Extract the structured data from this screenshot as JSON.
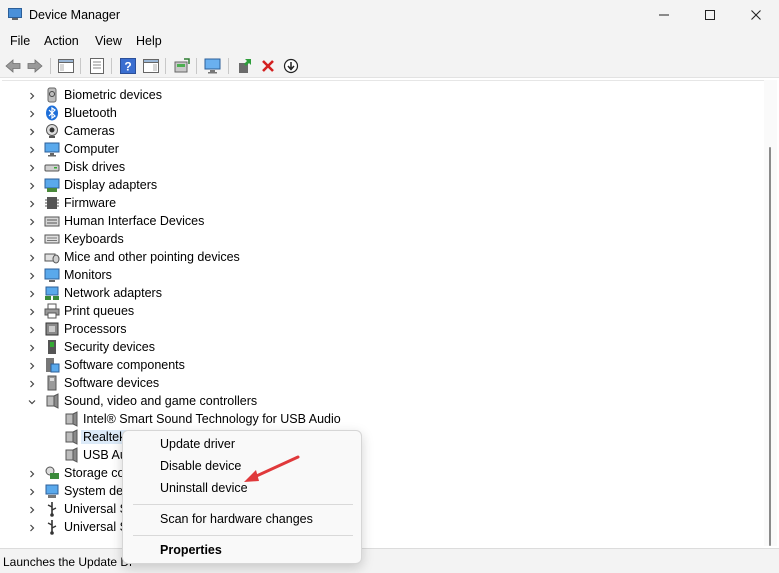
{
  "window": {
    "title": "Device Manager",
    "minimize_glyph": "—",
    "maximize_glyph": "☐",
    "close_glyph": "✕"
  },
  "menubar": {
    "items": [
      "File",
      "Action",
      "View",
      "Help"
    ]
  },
  "toolbar": {
    "icons": [
      "back-icon",
      "forward-icon",
      "show-hide-console-tree-icon",
      "properties-icon",
      "help-icon",
      "show-action-pane-icon",
      "update-driver-icon",
      "scan-hardware-icon",
      "enable-device-icon",
      "uninstall-device-icon",
      "disable-device-icon"
    ]
  },
  "tree": {
    "categories": [
      {
        "label": "Biometric devices",
        "icon": "biometric-icon",
        "expanded": false
      },
      {
        "label": "Bluetooth",
        "icon": "bluetooth-icon",
        "expanded": false
      },
      {
        "label": "Cameras",
        "icon": "camera-icon",
        "expanded": false
      },
      {
        "label": "Computer",
        "icon": "computer-icon",
        "expanded": false
      },
      {
        "label": "Disk drives",
        "icon": "disk-drive-icon",
        "expanded": false
      },
      {
        "label": "Display adapters",
        "icon": "display-adapter-icon",
        "expanded": false
      },
      {
        "label": "Firmware",
        "icon": "firmware-icon",
        "expanded": false
      },
      {
        "label": "Human Interface Devices",
        "icon": "hid-icon",
        "expanded": false
      },
      {
        "label": "Keyboards",
        "icon": "keyboard-icon",
        "expanded": false
      },
      {
        "label": "Mice and other pointing devices",
        "icon": "mouse-icon",
        "expanded": false
      },
      {
        "label": "Monitors",
        "icon": "monitor-icon",
        "expanded": false
      },
      {
        "label": "Network adapters",
        "icon": "network-adapter-icon",
        "expanded": false
      },
      {
        "label": "Print queues",
        "icon": "printer-icon",
        "expanded": false
      },
      {
        "label": "Processors",
        "icon": "processor-icon",
        "expanded": false
      },
      {
        "label": "Security devices",
        "icon": "security-device-icon",
        "expanded": false
      },
      {
        "label": "Software components",
        "icon": "software-component-icon",
        "expanded": false
      },
      {
        "label": "Software devices",
        "icon": "software-device-icon",
        "expanded": false
      },
      {
        "label": "Sound, video and game controllers",
        "icon": "speaker-icon",
        "expanded": true
      },
      {
        "label": "Intel® Smart Sound Technology for USB Audio",
        "icon": "speaker-icon",
        "child": true
      },
      {
        "label": "Realtek",
        "icon": "speaker-icon",
        "child": true,
        "selected": true
      },
      {
        "label": "USB Au",
        "icon": "speaker-icon",
        "child": true
      },
      {
        "label": "Storage co",
        "icon": "storage-controller-icon",
        "expanded": false
      },
      {
        "label": "System dev",
        "icon": "system-device-icon",
        "expanded": false
      },
      {
        "label": "Universal S",
        "icon": "usb-icon",
        "expanded": false
      },
      {
        "label": "Universal S",
        "icon": "usb-icon",
        "expanded": false
      }
    ]
  },
  "context_menu": {
    "items": [
      "Update driver",
      "Disable device",
      "Uninstall device",
      "Scan for hardware changes",
      "Properties"
    ]
  },
  "status": {
    "text": "Launches the Update Dr"
  },
  "colors": {
    "accent": "#0067c0",
    "selection": "#dceaf8",
    "annotation_arrow": "#e0393b"
  }
}
